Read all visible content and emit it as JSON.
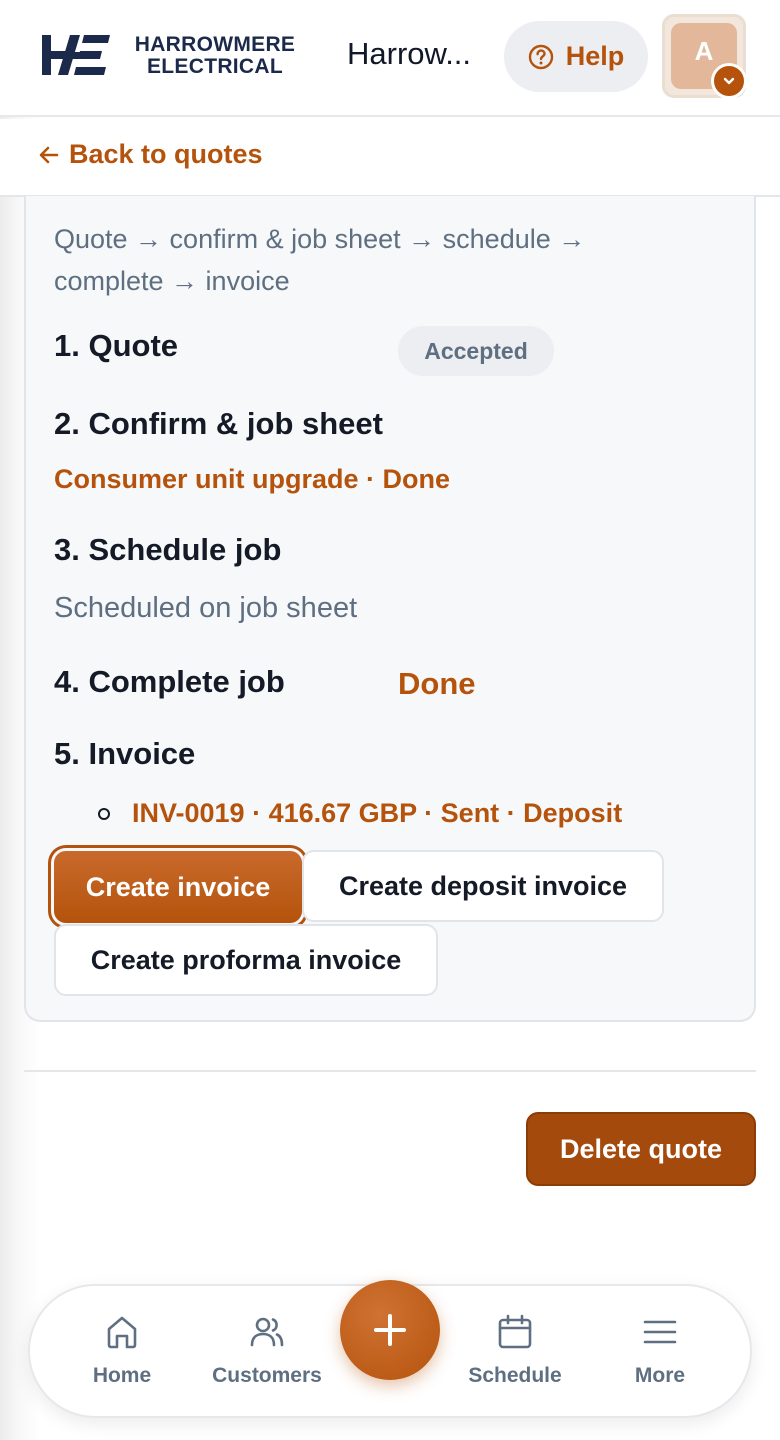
{
  "brand": {
    "logo_line1": "HARROWMERE",
    "logo_line2": "ELECTRICAL",
    "app_title": "Harrow...",
    "accent": "#b5530c",
    "navy": "#1b2a4a"
  },
  "header": {
    "help_label": "Help",
    "help_icon": "question-circle-icon",
    "avatar_initial": "A",
    "avatar_menu_icon": "chevron-down-icon"
  },
  "back": {
    "label": "Back to quotes",
    "icon": "arrow-left-icon"
  },
  "workflow": {
    "summary": "Quote → confirm & job sheet → schedule → complete → invoice",
    "steps": [
      {
        "title": "1. Quote",
        "status": "Accepted"
      },
      {
        "title": "2. Confirm & job sheet",
        "link": "Consumer unit upgrade · Done"
      },
      {
        "title": "3. Schedule job",
        "note": "Scheduled on job sheet"
      },
      {
        "title": "4. Complete job",
        "status": "Done"
      },
      {
        "title": "5. Invoice"
      }
    ],
    "invoices": [
      {
        "label": "INV-0019 · 416.67 GBP · Sent · Deposit"
      }
    ],
    "buttons": {
      "create_invoice": "Create invoice",
      "create_deposit": "Create deposit invoice",
      "create_proforma": "Create proforma invoice"
    }
  },
  "actions": {
    "delete_quote": "Delete quote"
  },
  "nav": {
    "items": [
      {
        "label": "Home",
        "icon": "home-icon"
      },
      {
        "label": "Customers",
        "icon": "users-icon"
      },
      {
        "label": "Schedule",
        "icon": "calendar-icon"
      },
      {
        "label": "More",
        "icon": "menu-icon"
      }
    ],
    "fab_icon": "plus-icon"
  }
}
